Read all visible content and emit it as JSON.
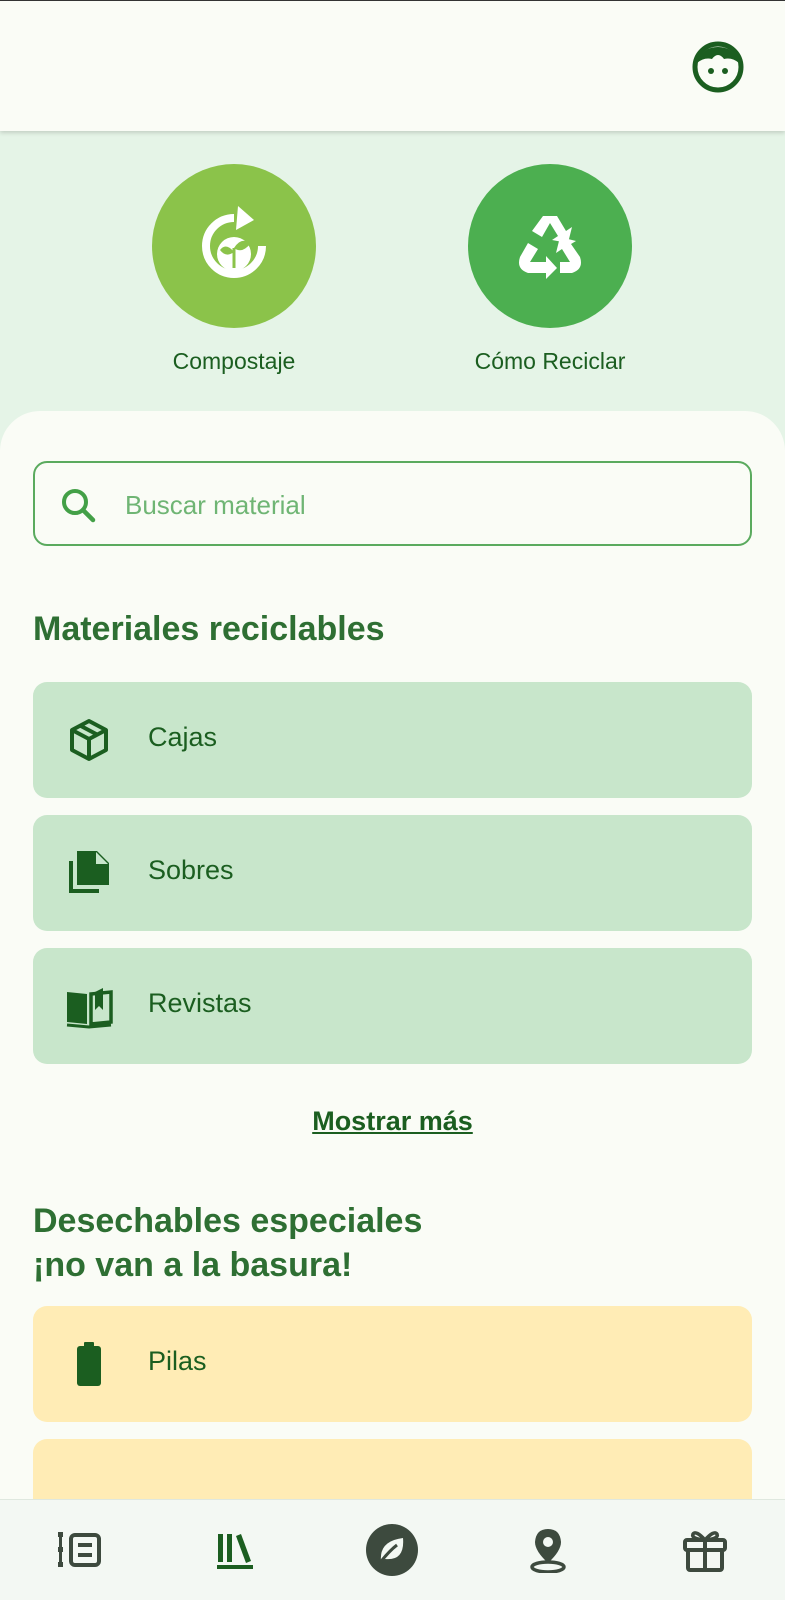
{
  "colors": {
    "primary": "#1b5e20",
    "hero_bg": "#e5f4e7",
    "compost_circle": "#8bc34a",
    "recycle_circle": "#4caf50",
    "card_green": "#c8e6cb",
    "card_yellow": "#ffecb5",
    "nav_icon": "#3d4a3e"
  },
  "header": {
    "avatar_icon": "kid-face-icon"
  },
  "hero": {
    "buttons": [
      {
        "label": "Compostaje",
        "icon": "compost-icon"
      },
      {
        "label": "Cómo Reciclar",
        "icon": "recycle-icon"
      }
    ]
  },
  "search": {
    "placeholder": "Buscar material",
    "value": "",
    "icon": "search-icon"
  },
  "recyclables": {
    "title": "Materiales reciclables",
    "items": [
      {
        "label": "Cajas",
        "icon": "box-icon"
      },
      {
        "label": "Sobres",
        "icon": "documents-icon"
      },
      {
        "label": "Revistas",
        "icon": "open-book-icon"
      }
    ],
    "more_label": "Mostrar más"
  },
  "special": {
    "title_line1": "Desechables especiales",
    "title_line2": "¡no van a la basura!",
    "items": [
      {
        "label": "Pilas",
        "icon": "battery-icon"
      },
      {
        "label": "",
        "icon": ""
      }
    ]
  },
  "bottom_nav": {
    "items": [
      {
        "icon": "list-icon",
        "active": false
      },
      {
        "icon": "library-icon",
        "active": true
      },
      {
        "icon": "leaf-icon",
        "active": false
      },
      {
        "icon": "location-pin-icon",
        "active": false
      },
      {
        "icon": "gift-icon",
        "active": false
      }
    ]
  }
}
